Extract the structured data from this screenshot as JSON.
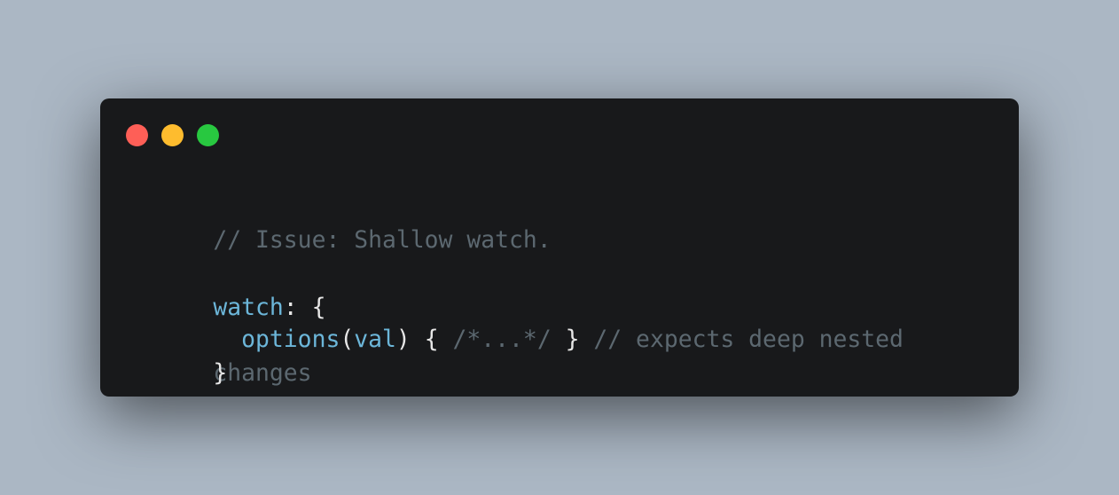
{
  "colors": {
    "background": "#abb7c4",
    "window": "#18191b",
    "close": "#fe5f57",
    "minimize": "#febc2e",
    "maximize": "#28c840",
    "comment": "#5c6870",
    "identifier": "#6cb6d9",
    "text": "#e6e6e6"
  },
  "window_controls": [
    "close-icon",
    "minimize-icon",
    "maximize-icon"
  ],
  "code": {
    "line1": {
      "comment": "// Issue: Shallow watch."
    },
    "line2": {
      "key": "watch",
      "rest": ": {"
    },
    "line3": {
      "indent": "  ",
      "method": "options",
      "paren_open": "(",
      "param": "val",
      "paren_close_brace": ") { ",
      "inline_comment": "/*...*/",
      "brace_close": " } ",
      "trailing_comment": "// expects deep nested"
    },
    "line4": {
      "wrapped_comment": "changes",
      "close_brace": "}"
    }
  }
}
